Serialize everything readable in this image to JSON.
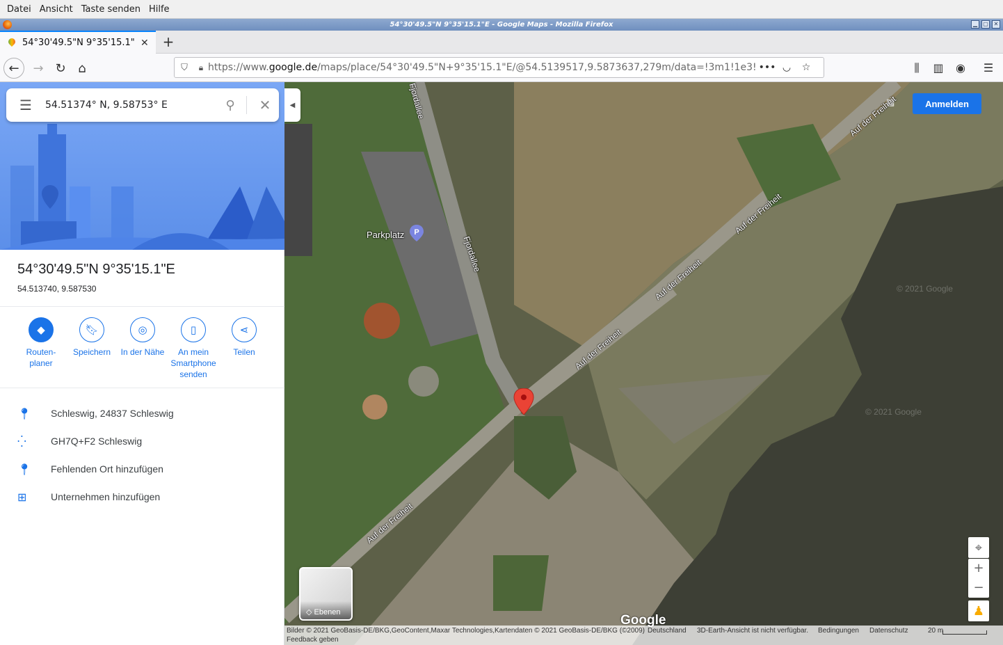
{
  "menubar": {
    "items": [
      "Datei",
      "Ansicht",
      "Taste senden",
      "Hilfe"
    ]
  },
  "window": {
    "title": "54°30'49.5\"N 9°35'15.1\"E - Google Maps - Mozilla Firefox"
  },
  "tab": {
    "title": "54°30'49.5\"N 9°35'15.1\"E"
  },
  "url": {
    "prefix": "https://www.",
    "domain": "google.de",
    "rest": "/maps/place/54°30'49.5\"N+9°35'15.1\"E/@54.5139517,9.5873637,279m/data=!3m1!1e3!"
  },
  "search": {
    "query": "54.51374° N, 9.58753° E"
  },
  "place": {
    "title": "54°30'49.5\"N 9°35'15.1\"E",
    "coords": "54.513740, 9.587530"
  },
  "actions": [
    {
      "label": "Routen-\nplaner",
      "icon": "directions-icon"
    },
    {
      "label": "Speichern",
      "icon": "bookmark-icon"
    },
    {
      "label": "In der Nähe",
      "icon": "nearby-icon"
    },
    {
      "label": "An mein\nSmartphone\nsenden",
      "icon": "phone-icon"
    },
    {
      "label": "Teilen",
      "icon": "share-icon"
    }
  ],
  "info": [
    {
      "text": "Schleswig, 24837 Schleswig",
      "icon": "location-pin-icon"
    },
    {
      "text": "GH7Q+F2 Schleswig",
      "icon": "plus-code-icon"
    },
    {
      "text": "Fehlenden Ort hinzufügen",
      "icon": "add-place-icon"
    },
    {
      "text": "Unternehmen hinzufügen",
      "icon": "add-business-icon"
    }
  ],
  "map": {
    "signin": "Anmelden",
    "poi": "Parkplatz",
    "roads": [
      "Fjordallee",
      "Fjordallee",
      "Auf der Freiheit",
      "Auf der Freiheit",
      "Auf der Freiheit",
      "Auf der Freiheit",
      "Auf der Freiheit"
    ],
    "layers_label": "Ebenen",
    "logo": "Google",
    "watermark": "© 2021 Google",
    "footer": {
      "imagery": "Bilder © 2021 GeoBasis-DE/BKG,GeoContent,Maxar Technologies,Kartendaten © 2021 GeoBasis-DE/BKG (©2009)",
      "country": "Deutschland",
      "earth": "3D-Earth-Ansicht ist nicht verfügbar.",
      "terms": "Bedingungen",
      "privacy": "Datenschutz",
      "scale": "20 m",
      "feedback": "Feedback geben"
    }
  },
  "colors": {
    "accent": "#1a73e8",
    "pin": "#ea4335",
    "water": "#3b3d33"
  }
}
